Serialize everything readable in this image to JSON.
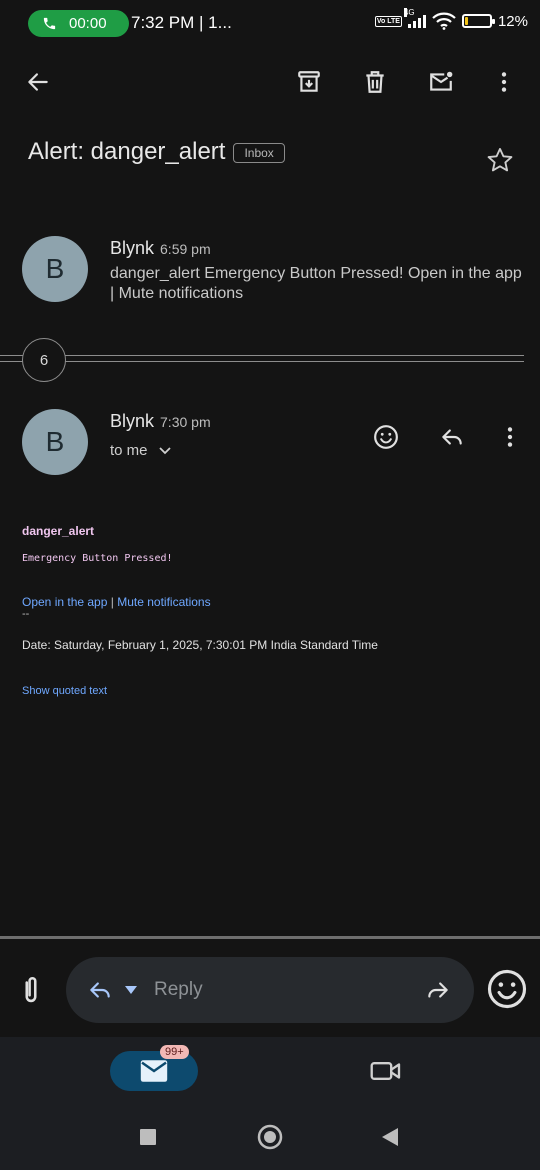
{
  "status_bar": {
    "call_timer": "00:00",
    "time": "7:32 PM | 1...",
    "volte": "Vo LTE",
    "network": "4G",
    "battery": "12%",
    "battery_level": 0.12
  },
  "app_bar": {
    "back_icon": "arrow-left-icon",
    "archive_icon": "archive-icon",
    "delete_icon": "trash-icon",
    "mark_unread_icon": "mail-unread-icon",
    "more_icon": "more-vert-icon"
  },
  "subject": {
    "text": "Alert: danger_alert",
    "label": "Inbox"
  },
  "messages": [
    {
      "avatar_letter": "B",
      "sender": "Blynk",
      "time": "6:59 pm",
      "snippet": "danger_alert Emergency Button Pressed! Open in the app | Mute notifications"
    },
    {
      "avatar_letter": "B",
      "sender": "Blynk",
      "time": "7:30 pm",
      "recipient": "to me"
    }
  ],
  "collapsed_count": "6",
  "email_body": {
    "title": "danger_alert",
    "message": "Emergency Button Pressed!",
    "link_open": "Open in the app",
    "link_separator": "|",
    "link_mute": "Mute notifications",
    "signature_dash": "--",
    "date_line": "Date: Saturday, February 1, 2025, 7:30:01 PM India Standard Time",
    "show_quoted": "Show quoted text"
  },
  "reply_bar": {
    "placeholder": "Reply"
  },
  "bottom_nav": {
    "mail_badge": "99+"
  },
  "colors": {
    "background": "#141414",
    "avatar": "#8ea3ad",
    "link": "#6fa8ff",
    "body_accent": "#f0c6ef",
    "call_pill": "#1f9d45",
    "mail_tab": "#0d4a6e"
  }
}
